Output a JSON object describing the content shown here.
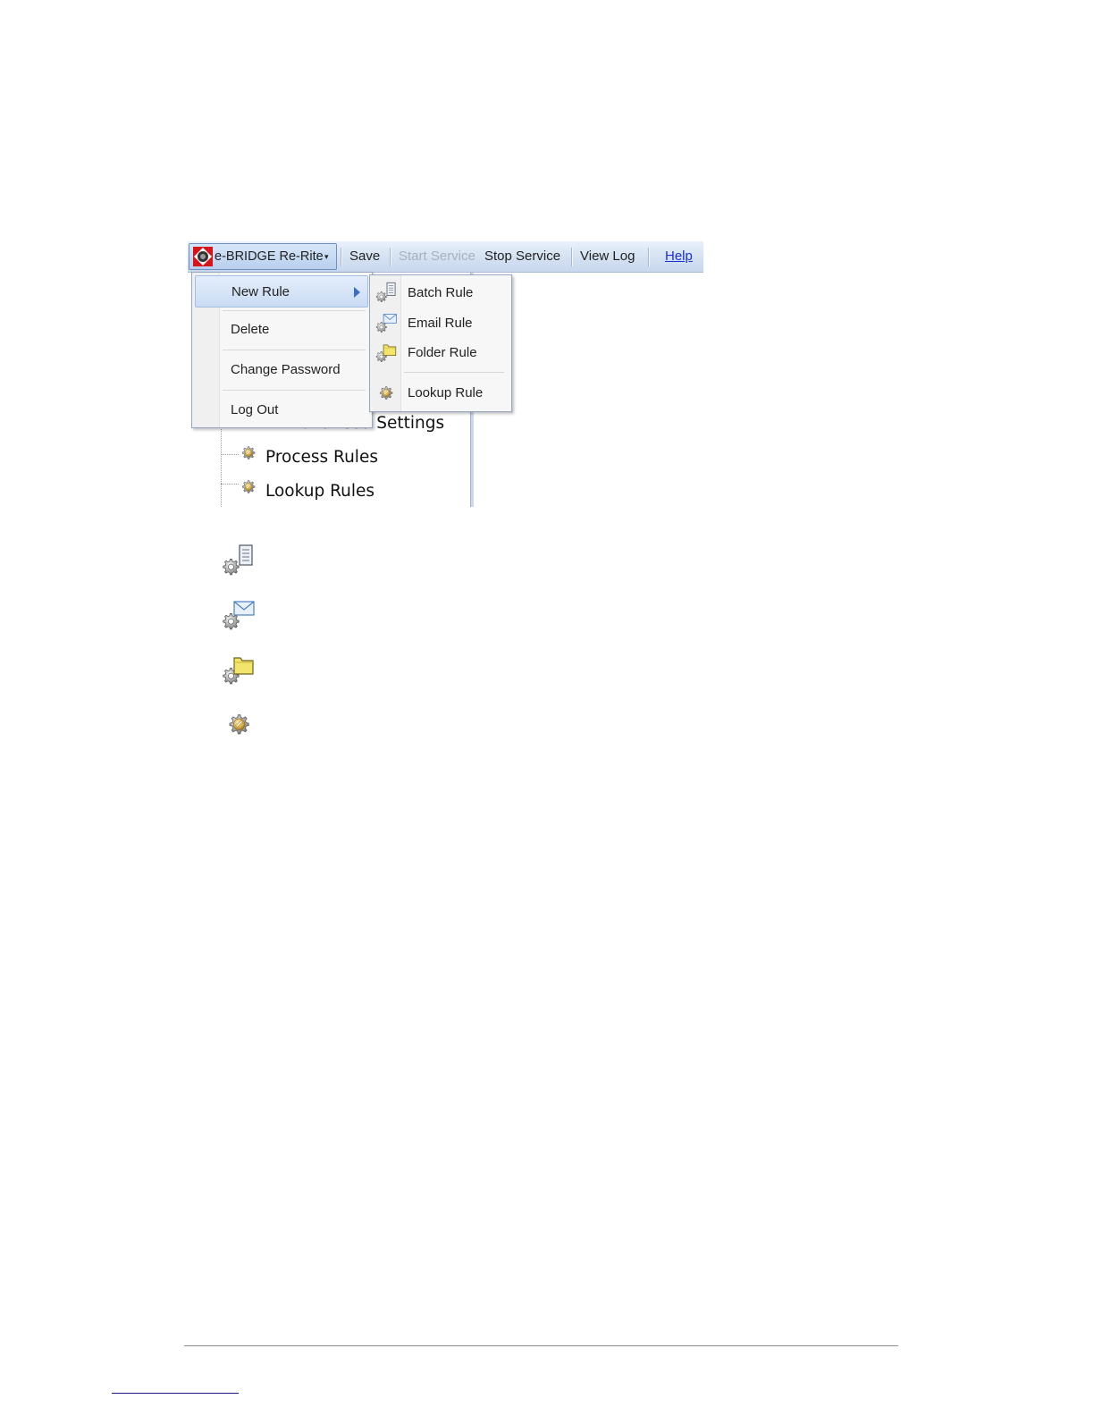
{
  "toolbar": {
    "app_name": "e-BRIDGE Re-Rite",
    "caret": "▾",
    "save": "Save",
    "start_service": "Start Service",
    "stop_service": "Stop Service",
    "view_log": "View Log",
    "help": "Help"
  },
  "app_menu": {
    "items": [
      {
        "label": "New Rule"
      },
      {
        "label": "Delete"
      },
      {
        "label": "Change Password"
      },
      {
        "label": "Log Out"
      }
    ]
  },
  "new_rule_submenu": {
    "items": [
      {
        "label": "Batch Rule",
        "icon": "batch-rule-icon"
      },
      {
        "label": "Email Rule",
        "icon": "email-rule-icon"
      },
      {
        "label": "Folder Rule",
        "icon": "folder-rule-icon"
      },
      {
        "label": "Lookup Rule",
        "icon": "lookup-rule-icon"
      }
    ]
  },
  "tree": {
    "items": [
      {
        "label": "Advanced Settings"
      },
      {
        "label": "Process Rules"
      },
      {
        "label": "Lookup Rules"
      }
    ]
  },
  "icon_list": [
    "batch-rule-icon",
    "email-rule-icon",
    "folder-rule-icon",
    "lookup-rule-icon"
  ],
  "colors": {
    "toolbar_bg": "#d4e1f2",
    "menu_highlight": "#c9dbf3",
    "link": "#1a2fd6",
    "disabled": "#a7b2c0"
  }
}
